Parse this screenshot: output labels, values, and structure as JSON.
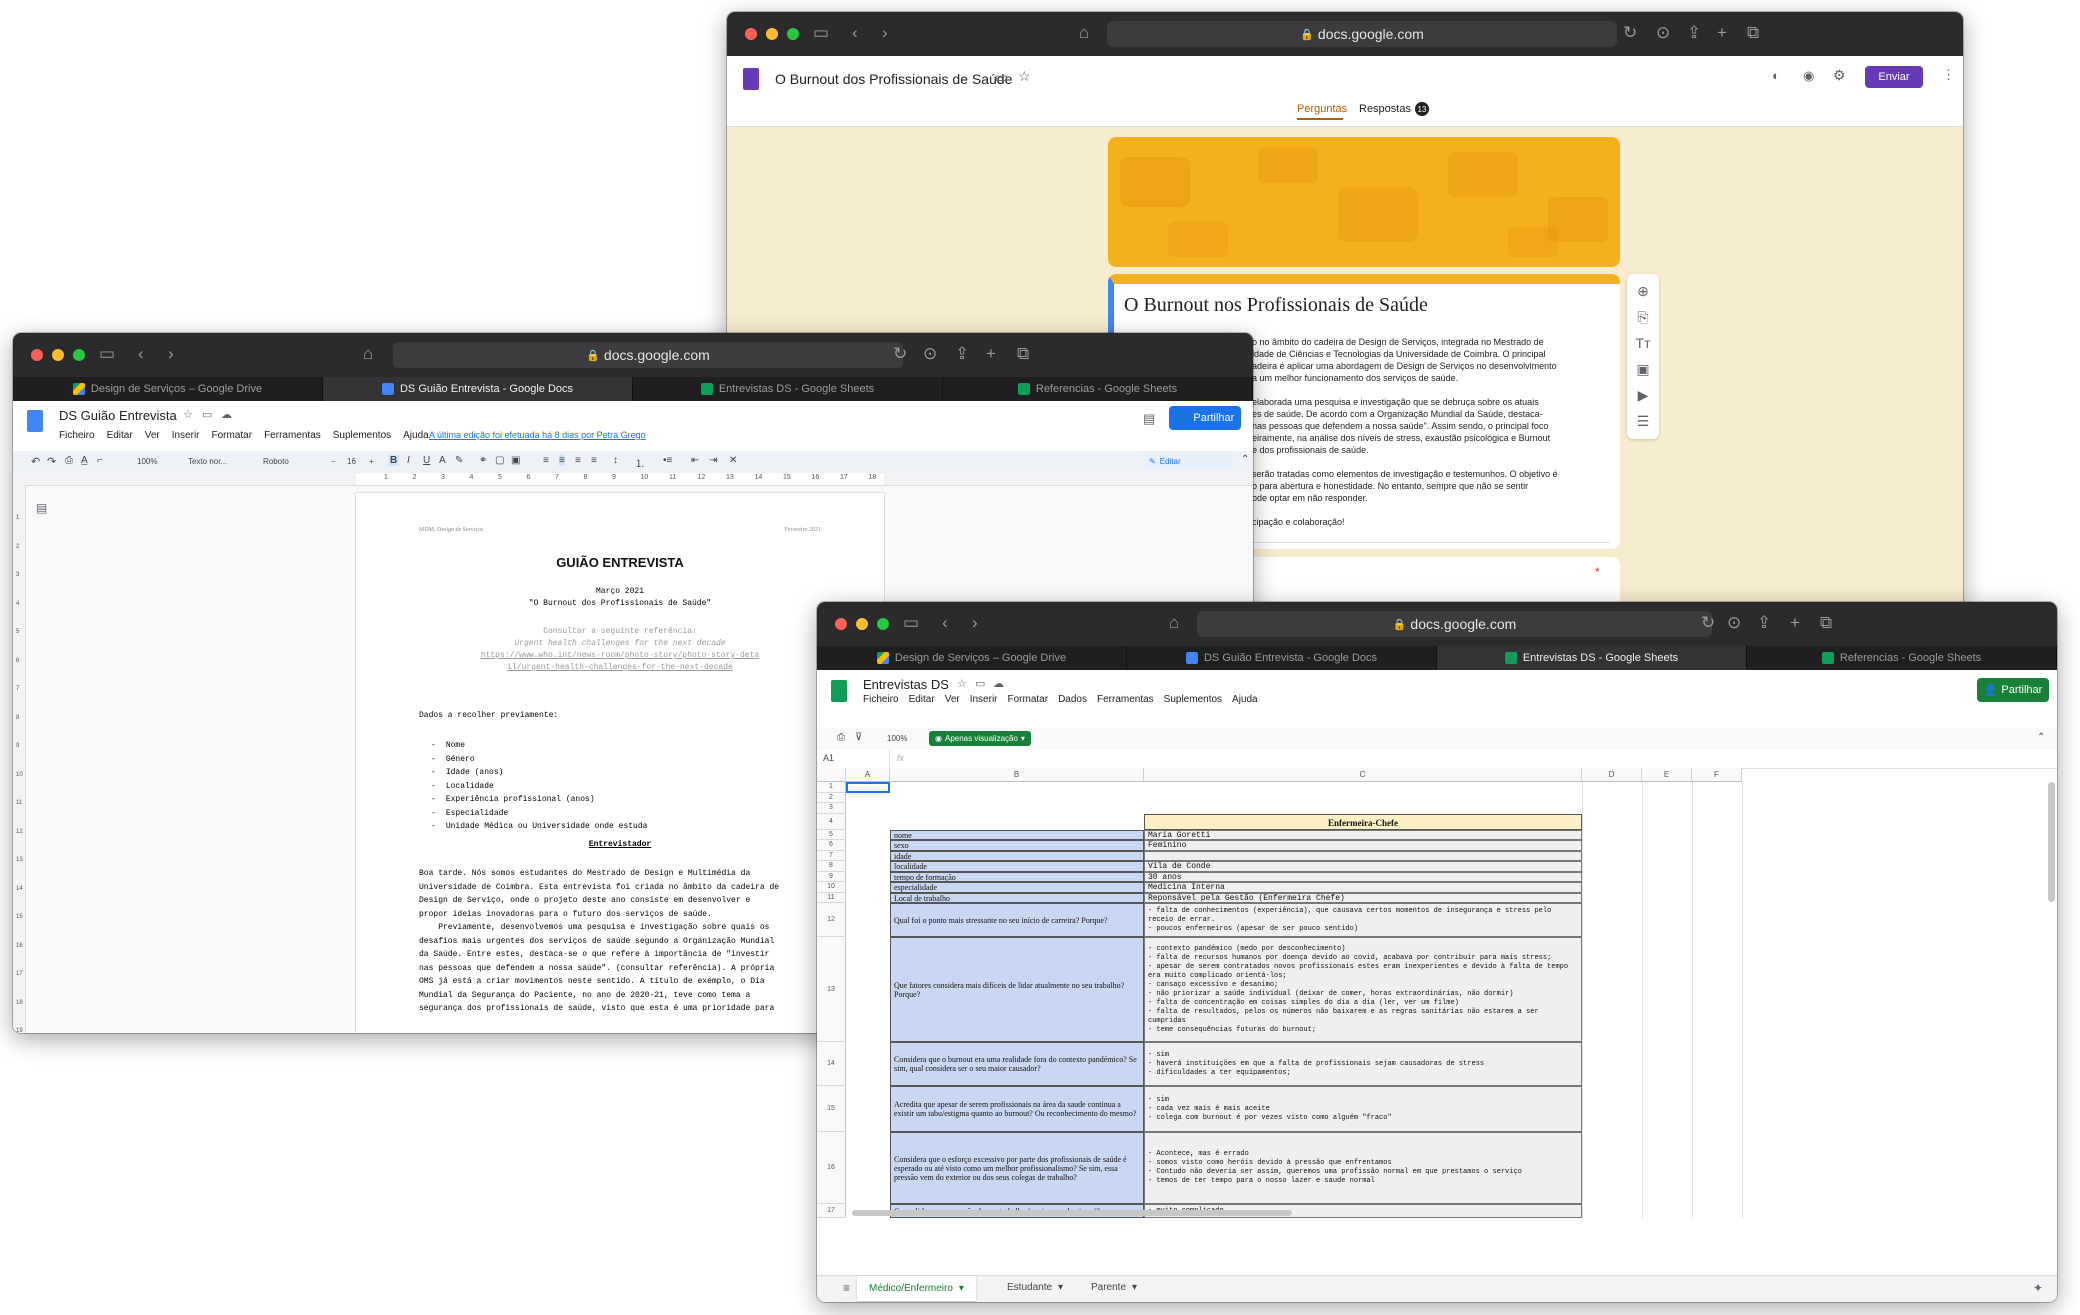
{
  "forms_window": {
    "url": "docs.google.com",
    "form_title": "O Burnout dos Profissionais de Saúde",
    "send_label": "Enviar",
    "tabs": [
      {
        "label": "Perguntas"
      },
      {
        "label": "Respostas"
      }
    ],
    "responses_count": "13",
    "card_title": "O Burnout nos Profissionais de Saúde",
    "card_lines": [
      "o no âmbito do cadeira de Design de Serviços, integrada no Mestrado de",
      "ldade de Ciências e Tecnologias da Universidade de Coimbra. O principal",
      "adeira é aplicar uma abordagem de Design de Serviços no desenvolvimento",
      "a um melhor funcionamento dos serviços de saúde.",
      "",
      "elaborada uma pesquisa e investigação que se debruça sobre os atuais",
      "es de saúde. De acordo com a Organização Mundial da Saúde, destaca-",
      "nas pessoas que defendem a nossa saúde\". Assim sendo, o principal foco",
      "eiramente, na análise dos níveis de stress, exaustão psicológica e Burnout",
      "e dos profissionais de saúde.",
      "",
      "serão tratadas como elementos de investigação e testemunhos. O objetivo é",
      "o para abertura e honestidade. No entanto, sempre que não se sentir",
      "ode optar em não responder.",
      "",
      "cipação e colaboração!"
    ],
    "required_mark": "*"
  },
  "docs_window": {
    "url": "docs.google.com",
    "tabs": [
      {
        "label": "Design de Serviços – Google Drive",
        "icon": "drive"
      },
      {
        "label": "DS Guião Entrevista - Google Docs",
        "icon": "docs"
      },
      {
        "label": "Entrevistas DS - Google Sheets",
        "icon": "sheets"
      },
      {
        "label": "Referencias - Google Sheets",
        "icon": "sheets"
      }
    ],
    "doc_title": "DS Guião Entrevista",
    "menus": [
      "Ficheiro",
      "Editar",
      "Ver",
      "Inserir",
      "Formatar",
      "Ferramentas",
      "Suplementos",
      "Ajuda"
    ],
    "last_edit": "A última edição foi efetuada há 8 dias por Petra Grego",
    "share_label": "Partilhar",
    "toolbar": {
      "zoom": "100%",
      "style": "Texto nor...",
      "font": "Roboto",
      "size": "16",
      "mode": "Editar"
    },
    "ruler_numbers": [
      "1",
      "2",
      "3",
      "4",
      "5",
      "6",
      "7",
      "8",
      "9",
      "10",
      "11",
      "12",
      "13",
      "14",
      "15",
      "16",
      "17",
      "18"
    ],
    "vruler_numbers": [
      "1",
      "2",
      "3",
      "4",
      "5",
      "6",
      "7",
      "8",
      "9",
      "10",
      "11",
      "12",
      "13",
      "14",
      "15",
      "16",
      "17",
      "18",
      "19"
    ],
    "page": {
      "header_left": "MDM, Design de Serviços",
      "header_right": "Fevereiro 2021",
      "heading": "GUIÃO ENTREVISTA",
      "date": "Março 2021",
      "subtitle": "\"O Burnout dos Profissionais de Saúde\"",
      "ref_label": "Consultar a seguinte referência:",
      "ref_title": "Urgent health challenges for the next decade",
      "ref_link_1": "https://www.who.int/news-room/photo-story/photo-story-deta",
      "ref_link_2": "il/urgent-health-challenges-for-the-next-decade",
      "data_intro": "Dados a recolher previamente:",
      "data_items": [
        "Nome",
        "Género",
        "Idade (anos)",
        "Localidade",
        "Experiência profissional (anos)",
        "Especialidade",
        "Unidade Médica ou Universidade onde estuda"
      ],
      "section": "Entrevistador",
      "para_lines": [
        "Boa tarde. Nós somos estudantes do Mestrado de Design e Multimédia da",
        "Universidade de Coimbra. Esta entrevista foi criada no âmbito da cadeira de",
        "Design de Serviço, onde o projeto deste ano consiste em desenvolver e",
        "propor ideias inovadoras para o futuro dos serviços de saúde.",
        "    Previamente, desenvolvemos uma pesquisa e investigação sobre quais os",
        "desafios mais urgentes dos serviços de saúde segundo a Organização Mundial",
        "da Saúde. Entre estes, destaca-se o que refere à importância de \"investir",
        "nas pessoas que defendem a nossa saúde\". (consultar referência). A própria",
        "OMS já está a criar movimentos neste sentido. A título de exemplo, o Dia",
        "Mundial da Segurança do Paciente, no ano de 2020-21, teve como tema a",
        "segurança dos profissionais de saúde, visto que esta é uma prioridade para"
      ]
    }
  },
  "sheets_window": {
    "url": "docs.google.com",
    "tabs": [
      {
        "label": "Design de Serviços – Google Drive",
        "icon": "drive"
      },
      {
        "label": "DS Guião Entrevista - Google Docs",
        "icon": "docs"
      },
      {
        "label": "Entrevistas DS - Google Sheets",
        "icon": "sheets"
      },
      {
        "label": "Referencias - Google Sheets",
        "icon": "sheets"
      }
    ],
    "doc_title": "Entrevistas DS",
    "menus": [
      "Ficheiro",
      "Editar",
      "Ver",
      "Inserir",
      "Formatar",
      "Dados",
      "Ferramentas",
      "Suplementos",
      "Ajuda"
    ],
    "share_label": "Partilhar",
    "zoom": "100%",
    "view_only": "Apenas visualização",
    "cell_ref": "A1",
    "fx": "fx",
    "col_headers": [
      "A",
      "B",
      "C",
      "D",
      "E",
      "F"
    ],
    "header_cell": "Enfermeira-Chefe",
    "fields": [
      {
        "row": "5",
        "label": "nome",
        "value": "Maria Goretti"
      },
      {
        "row": "6",
        "label": "sexo",
        "value": "Feminino"
      },
      {
        "row": "7",
        "label": "idade",
        "value": ""
      },
      {
        "row": "8",
        "label": "localidade",
        "value": "Vila de Conde"
      },
      {
        "row": "9",
        "label": "tempo de formação",
        "value": "30 anos"
      },
      {
        "row": "10",
        "label": "especialidade",
        "value": "Medicina Interna"
      },
      {
        "row": "11",
        "label": "Local de trabalho",
        "value": "Reponsável pela Gestão (Enfermeira Chefe)"
      }
    ],
    "questions": [
      {
        "row": "12",
        "q": "Qual foi o ponto mais stressante no seu início de carreira? Porque?",
        "a": [
          "- falta de conhecimentos (experiência), que causava certos momentos de insegurança e stress pelo receio de errar.",
          "- poucos enfermeiros (apesar de ser pouco sentido)"
        ]
      },
      {
        "row": "13",
        "q": "Que fatores considera mais difíceis de lidar  atualmente no seu trabalho? Porque?",
        "a": [
          "- contexto pandémico (medo por desconhecimento)",
          "- falta de recursos humanos por doença devido ao covid, acabava por contribuir para mais stress;",
          "- apesar de serem contratados novos profissionais estes eram inexperientes e devido à falta de tempo era muito complicado orientá-los;",
          "- cansaço excessivo e desanimo;",
          "- não priorizar a saúde individual (deixar de comer, horas extraordinárias, não dormir)",
          "- falta de concentração em coisas simples do dia a dia (ler, ver um filme)",
          "- falta de resultados, pelos os números não baixarem e as regras sanitárias não estarem a ser cumpridas",
          "- teme consequências futuras do burnout;"
        ]
      },
      {
        "row": "14",
        "q": "Considera que o burnout era uma realidade fora do contexto pandémico? Se sim, qual considera ser o seu maior causador?",
        "a": [
          "- sim",
          "- haverá instituições em que a falta de profissionais sejam causadoras de stress",
          "- dificuldades a ter equipamentos;"
        ]
      },
      {
        "row": "15",
        "q": "Acredita que apesar de serem profissionais na área da saude continua a existir um tabu/estigma quanto ao burnout? Ou reconhecimento do mesmo?",
        "a": [
          "- sim",
          "- cada vez mais é mais aceite",
          "- colega com burnout é por vezes visto como alguém \"fraco\""
        ]
      },
      {
        "row": "16",
        "q": "Considera que o esforço excessivo por parte dos profissionais de saúde é esperado ou até visto como um melhor profissionalismo? Se sim, essa pressão vem do exterior ou dos seus colegas de trabalho?",
        "a": [
          "- Acontece, mas é errado",
          "- somos visto como heróis devido à pressão que enfrentamos",
          "- Contudo não deveria ser assim, queremos uma profissão normal em que prestamos o serviço",
          "- temos de ter tempo para o nosso lazer e saude normal"
        ]
      },
      {
        "row": "17",
        "q": "Como lida com a pressão do seu trabalho (coping mechanisms)?",
        "a": [
          "- muito complicado"
        ]
      }
    ],
    "sheet_tabs": [
      {
        "label": "Médico/Enfermeiro"
      },
      {
        "label": "Estudante"
      },
      {
        "label": "Parente"
      }
    ]
  }
}
